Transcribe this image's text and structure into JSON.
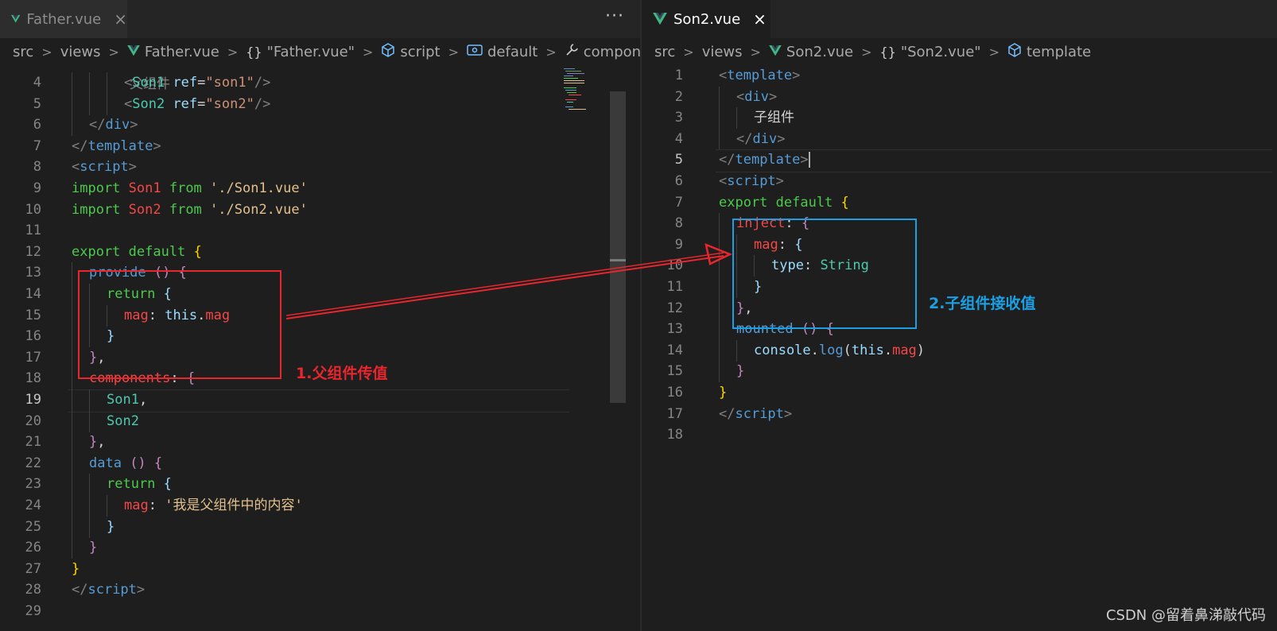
{
  "left_pane": {
    "tab": {
      "label": "Father.vue",
      "close": "×"
    },
    "more_actions": "···",
    "breadcrumb": [
      {
        "text": "src",
        "icon": ""
      },
      {
        "text": "views",
        "icon": ""
      },
      {
        "text": "Father.vue",
        "icon": "vue-file-icon"
      },
      {
        "text": "\"Father.vue\"",
        "icon": "braces-icon"
      },
      {
        "text": "script",
        "icon": "cube-icon"
      },
      {
        "text": "default",
        "icon": "symbol-icon"
      },
      {
        "text": "components",
        "icon": "wrench-icon"
      }
    ],
    "breadcrumb_sep": ">",
    "partial_top": "父组件",
    "current_line": 19,
    "lines": [
      {
        "n": "4",
        "indent": 3,
        "t": [
          [
            "<",
            "k-gray"
          ],
          [
            "Son1",
            "k-teal"
          ],
          [
            " ref",
            "k-ltblue"
          ],
          [
            "=",
            "k-white"
          ],
          [
            "\"son1\"",
            "k-orange"
          ],
          [
            "/>",
            "k-gray"
          ]
        ]
      },
      {
        "n": "5",
        "indent": 3,
        "t": [
          [
            "<",
            "k-gray"
          ],
          [
            "Son2",
            "k-teal"
          ],
          [
            " ref",
            "k-ltblue"
          ],
          [
            "=",
            "k-white"
          ],
          [
            "\"son2\"",
            "k-orange"
          ],
          [
            "/>",
            "k-gray"
          ]
        ]
      },
      {
        "n": "6",
        "indent": 1,
        "t": [
          [
            "</",
            "k-gray"
          ],
          [
            "div",
            "k-blue"
          ],
          [
            ">",
            "k-gray"
          ]
        ]
      },
      {
        "n": "7",
        "indent": 0,
        "t": [
          [
            "</",
            "k-gray"
          ],
          [
            "template",
            "k-blue"
          ],
          [
            ">",
            "k-gray"
          ]
        ]
      },
      {
        "n": "8",
        "indent": 0,
        "t": [
          [
            "<",
            "k-gray"
          ],
          [
            "script",
            "k-blue"
          ],
          [
            ">",
            "k-gray"
          ]
        ]
      },
      {
        "n": "9",
        "indent": 0,
        "t": [
          [
            "import ",
            "k-green"
          ],
          [
            "Son1",
            "k-red"
          ],
          [
            " from ",
            "k-green"
          ],
          [
            "'./Son1.vue'",
            "k-str"
          ]
        ]
      },
      {
        "n": "10",
        "indent": 0,
        "t": [
          [
            "import ",
            "k-green"
          ],
          [
            "Son2",
            "k-red"
          ],
          [
            " from ",
            "k-green"
          ],
          [
            "'./Son2.vue'",
            "k-str"
          ]
        ]
      },
      {
        "n": "11",
        "indent": 0,
        "t": []
      },
      {
        "n": "12",
        "indent": 0,
        "t": [
          [
            "export default ",
            "k-green"
          ],
          [
            "{",
            "k-yellow"
          ]
        ]
      },
      {
        "n": "13",
        "indent": 1,
        "t": [
          [
            "provide",
            "k-blue"
          ],
          [
            " () ",
            "k-purple"
          ],
          [
            "{",
            "k-purple"
          ]
        ]
      },
      {
        "n": "14",
        "indent": 2,
        "t": [
          [
            "return ",
            "k-green"
          ],
          [
            "{",
            "k-ltblue"
          ]
        ]
      },
      {
        "n": "15",
        "indent": 3,
        "t": [
          [
            "mag",
            "k-red"
          ],
          [
            ": ",
            "k-white"
          ],
          [
            "this",
            "k-ltblue"
          ],
          [
            ".",
            "k-white"
          ],
          [
            "mag",
            "k-red"
          ]
        ]
      },
      {
        "n": "16",
        "indent": 2,
        "t": [
          [
            "}",
            "k-ltblue"
          ]
        ]
      },
      {
        "n": "17",
        "indent": 1,
        "t": [
          [
            "}",
            "k-purple"
          ],
          [
            ",",
            "k-white"
          ]
        ]
      },
      {
        "n": "18",
        "indent": 1,
        "t": [
          [
            "components",
            "k-red"
          ],
          [
            ": ",
            "k-white"
          ],
          [
            "{",
            "k-purple"
          ]
        ]
      },
      {
        "n": "19",
        "indent": 2,
        "t": [
          [
            "Son1",
            "k-teal"
          ],
          [
            ",",
            "k-white"
          ]
        ]
      },
      {
        "n": "20",
        "indent": 2,
        "t": [
          [
            "Son2",
            "k-teal"
          ]
        ]
      },
      {
        "n": "21",
        "indent": 1,
        "t": [
          [
            "}",
            "k-purple"
          ],
          [
            ",",
            "k-white"
          ]
        ]
      },
      {
        "n": "22",
        "indent": 1,
        "t": [
          [
            "data",
            "k-blue"
          ],
          [
            " () ",
            "k-purple"
          ],
          [
            "{",
            "k-purple"
          ]
        ]
      },
      {
        "n": "23",
        "indent": 2,
        "t": [
          [
            "return ",
            "k-green"
          ],
          [
            "{",
            "k-ltblue"
          ]
        ]
      },
      {
        "n": "24",
        "indent": 3,
        "t": [
          [
            "mag",
            "k-red"
          ],
          [
            ": ",
            "k-white"
          ],
          [
            "'我是父组件中的内容'",
            "k-str"
          ]
        ]
      },
      {
        "n": "25",
        "indent": 2,
        "t": [
          [
            "}",
            "k-ltblue"
          ]
        ]
      },
      {
        "n": "26",
        "indent": 1,
        "t": [
          [
            "}",
            "k-purple"
          ]
        ]
      },
      {
        "n": "27",
        "indent": 0,
        "t": [
          [
            "}",
            "k-yellow"
          ]
        ]
      },
      {
        "n": "28",
        "indent": 0,
        "t": [
          [
            "</",
            "k-gray"
          ],
          [
            "script",
            "k-blue"
          ],
          [
            ">",
            "k-gray"
          ]
        ]
      },
      {
        "n": "29",
        "indent": 0,
        "t": []
      }
    ]
  },
  "right_pane": {
    "tab": {
      "label": "Son2.vue",
      "close": "×"
    },
    "breadcrumb": [
      {
        "text": "src",
        "icon": ""
      },
      {
        "text": "views",
        "icon": ""
      },
      {
        "text": "Son2.vue",
        "icon": "vue-file-icon"
      },
      {
        "text": "\"Son2.vue\"",
        "icon": "braces-icon"
      },
      {
        "text": "template",
        "icon": "cube-icon"
      }
    ],
    "breadcrumb_sep": ">",
    "current_line": 5,
    "lines": [
      {
        "n": "1",
        "indent": 0,
        "t": [
          [
            "<",
            "k-gray"
          ],
          [
            "template",
            "k-blue"
          ],
          [
            ">",
            "k-gray"
          ]
        ]
      },
      {
        "n": "2",
        "indent": 1,
        "t": [
          [
            "<",
            "k-gray"
          ],
          [
            "div",
            "k-blue"
          ],
          [
            ">",
            "k-gray"
          ]
        ]
      },
      {
        "n": "3",
        "indent": 2,
        "t": [
          [
            "子组件",
            "k-white"
          ]
        ]
      },
      {
        "n": "4",
        "indent": 1,
        "t": [
          [
            "</",
            "k-gray"
          ],
          [
            "div",
            "k-blue"
          ],
          [
            ">",
            "k-gray"
          ]
        ]
      },
      {
        "n": "5",
        "indent": 0,
        "t": [
          [
            "</",
            "k-gray"
          ],
          [
            "template",
            "k-blue"
          ],
          [
            ">",
            "k-gray"
          ]
        ],
        "cursor": true
      },
      {
        "n": "6",
        "indent": 0,
        "t": [
          [
            "<",
            "k-gray"
          ],
          [
            "script",
            "k-blue"
          ],
          [
            ">",
            "k-gray"
          ]
        ]
      },
      {
        "n": "7",
        "indent": 0,
        "t": [
          [
            "export default ",
            "k-green"
          ],
          [
            "{",
            "k-yellow"
          ]
        ]
      },
      {
        "n": "8",
        "indent": 1,
        "t": [
          [
            "inject",
            "k-red"
          ],
          [
            ": ",
            "k-white"
          ],
          [
            "{",
            "k-purple"
          ]
        ]
      },
      {
        "n": "9",
        "indent": 2,
        "t": [
          [
            "mag",
            "k-red"
          ],
          [
            ": ",
            "k-white"
          ],
          [
            "{",
            "k-ltblue"
          ]
        ]
      },
      {
        "n": "10",
        "indent": 3,
        "t": [
          [
            "type",
            "k-ltblue"
          ],
          [
            ": ",
            "k-white"
          ],
          [
            "String",
            "k-teal"
          ]
        ]
      },
      {
        "n": "11",
        "indent": 2,
        "t": [
          [
            "}",
            "k-ltblue"
          ]
        ]
      },
      {
        "n": "12",
        "indent": 1,
        "t": [
          [
            "}",
            "k-purple"
          ],
          [
            ",",
            "k-white"
          ]
        ]
      },
      {
        "n": "13",
        "indent": 1,
        "t": [
          [
            "mounted",
            "k-blue"
          ],
          [
            " () ",
            "k-purple"
          ],
          [
            "{",
            "k-purple"
          ]
        ]
      },
      {
        "n": "14",
        "indent": 2,
        "t": [
          [
            "console",
            "k-ltblue"
          ],
          [
            ".",
            "k-white"
          ],
          [
            "log",
            "k-blue"
          ],
          [
            "(",
            "k-white"
          ],
          [
            "this",
            "k-ltblue"
          ],
          [
            ".",
            "k-white"
          ],
          [
            "mag",
            "k-red"
          ],
          [
            ")",
            "k-white"
          ]
        ]
      },
      {
        "n": "15",
        "indent": 1,
        "t": [
          [
            "}",
            "k-purple"
          ]
        ]
      },
      {
        "n": "16",
        "indent": 0,
        "t": [
          [
            "}",
            "k-yellow"
          ]
        ]
      },
      {
        "n": "17",
        "indent": 0,
        "t": [
          [
            "</",
            "k-gray"
          ],
          [
            "script",
            "k-blue"
          ],
          [
            ">",
            "k-gray"
          ]
        ]
      },
      {
        "n": "18",
        "indent": 0,
        "t": []
      }
    ]
  },
  "annotations": {
    "left_label": "1.父组件传值",
    "right_label": "2.子组件接收值",
    "left_color": "#e8262d",
    "right_color": "#1ca0e3"
  },
  "watermark": "CSDN @留着鼻涕敲代码",
  "colors": {
    "editor_bg": "#1e1e1e",
    "vue_green": "#41b883"
  }
}
